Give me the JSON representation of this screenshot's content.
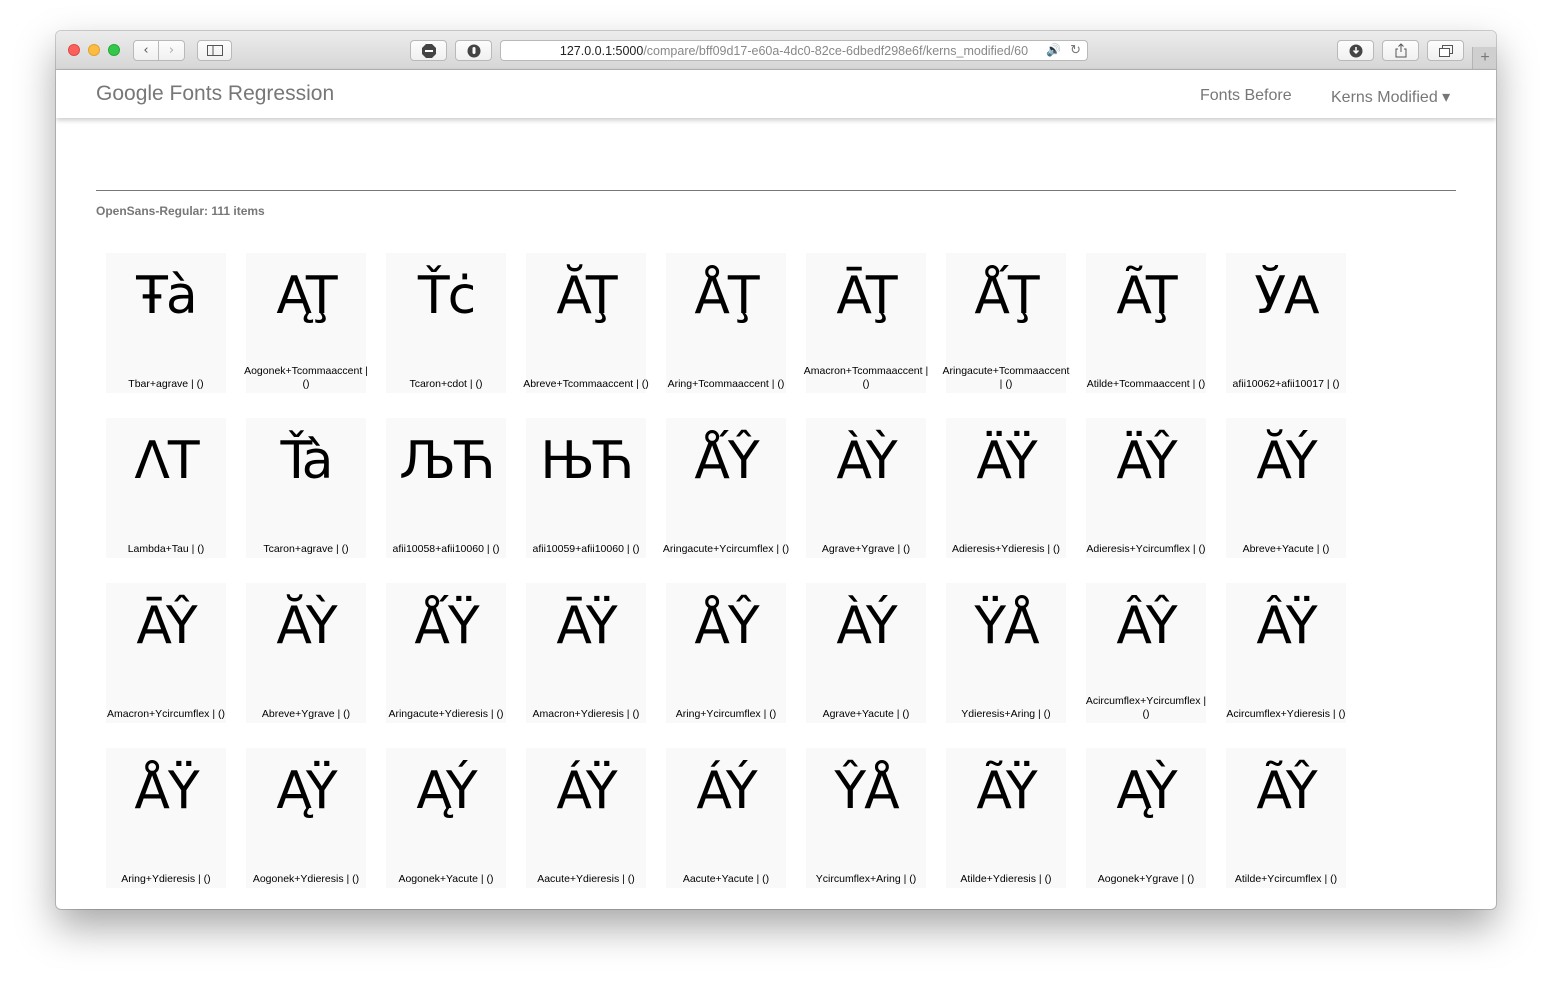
{
  "browser": {
    "url_host": "127.0.0.1:5000",
    "url_path": "/compare/bff09d17-e60a-4dc0-82ce-6dbedf298e6f/kerns_modified/60"
  },
  "header": {
    "brand": "Google Fonts Regression",
    "nav": {
      "fonts_before": "Fonts Before",
      "kerns_modified": "Kerns Modified ▾"
    }
  },
  "section": {
    "title": "OpenSans-Regular: 111 items"
  },
  "items": [
    {
      "glyphs": "Ŧà",
      "caption": "Tbar+agrave | ()"
    },
    {
      "glyphs": "ĄŢ",
      "caption": "Aogonek+Tcommaaccent | ()"
    },
    {
      "glyphs": "Ťċ",
      "caption": "Tcaron+cdot | ()"
    },
    {
      "glyphs": "ĂŢ",
      "caption": "Abreve+Tcommaaccent | ()"
    },
    {
      "glyphs": "ÅŢ",
      "caption": "Aring+Tcommaaccent | ()"
    },
    {
      "glyphs": "ĀŢ",
      "caption": "Amacron+Tcommaaccent | ()"
    },
    {
      "glyphs": "ǺŢ",
      "caption": "Aringacute+Tcommaaccent | ()"
    },
    {
      "glyphs": "ÃŢ",
      "caption": "Atilde+Tcommaaccent | ()"
    },
    {
      "glyphs": "ЎА",
      "caption": "afii10062+afii10017 | ()"
    },
    {
      "glyphs": "ΛΤ",
      "caption": "Lambda+Tau | ()"
    },
    {
      "glyphs": "Ťà",
      "caption": "Tcaron+agrave | ()"
    },
    {
      "glyphs": "ЉЋ",
      "caption": "afii10058+afii10060 | ()"
    },
    {
      "glyphs": "ЊЋ",
      "caption": "afii10059+afii10060 | ()"
    },
    {
      "glyphs": "ǺŶ",
      "caption": "Aringacute+Ycircumflex | ()"
    },
    {
      "glyphs": "ÀỲ",
      "caption": "Agrave+Ygrave | ()"
    },
    {
      "glyphs": "ÄŸ",
      "caption": "Adieresis+Ydieresis | ()"
    },
    {
      "glyphs": "ÄŶ",
      "caption": "Adieresis+Ycircumflex | ()"
    },
    {
      "glyphs": "ĂÝ",
      "caption": "Abreve+Yacute | ()"
    },
    {
      "glyphs": "ĀŶ",
      "caption": "Amacron+Ycircumflex | ()"
    },
    {
      "glyphs": "ĂỲ",
      "caption": "Abreve+Ygrave | ()"
    },
    {
      "glyphs": "ǺŸ",
      "caption": "Aringacute+Ydieresis | ()"
    },
    {
      "glyphs": "ĀŸ",
      "caption": "Amacron+Ydieresis | ()"
    },
    {
      "glyphs": "ÅŶ",
      "caption": "Aring+Ycircumflex | ()"
    },
    {
      "glyphs": "ÀÝ",
      "caption": "Agrave+Yacute | ()"
    },
    {
      "glyphs": "ŸÅ",
      "caption": "Ydieresis+Aring | ()"
    },
    {
      "glyphs": "ÂŶ",
      "caption": "Acircumflex+Ycircumflex | ()"
    },
    {
      "glyphs": "ÂŸ",
      "caption": "Acircumflex+Ydieresis | ()"
    },
    {
      "glyphs": "ÅŸ",
      "caption": "Aring+Ydieresis | ()"
    },
    {
      "glyphs": "ĄŸ",
      "caption": "Aogonek+Ydieresis | ()"
    },
    {
      "glyphs": "ĄÝ",
      "caption": "Aogonek+Yacute | ()"
    },
    {
      "glyphs": "ÁŸ",
      "caption": "Aacute+Ydieresis | ()"
    },
    {
      "glyphs": "ÁÝ",
      "caption": "Aacute+Yacute | ()"
    },
    {
      "glyphs": "ŶÅ",
      "caption": "Ycircumflex+Aring | ()"
    },
    {
      "glyphs": "ÃŸ",
      "caption": "Atilde+Ydieresis | ()"
    },
    {
      "glyphs": "ĄỲ",
      "caption": "Aogonek+Ygrave | ()"
    },
    {
      "glyphs": "ÃŶ",
      "caption": "Atilde+Ycircumflex | ()"
    }
  ]
}
